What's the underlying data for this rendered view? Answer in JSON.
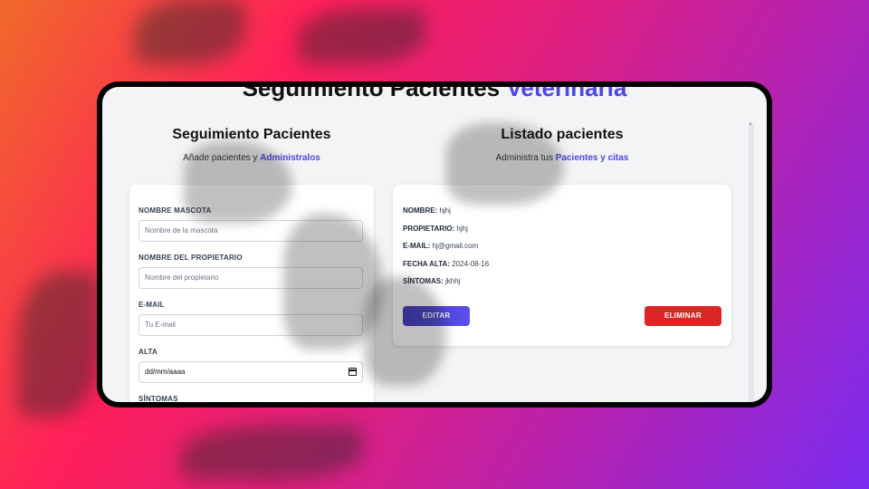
{
  "app": {
    "title_main": "Seguimiento Pacientes",
    "title_accent": "Veterinaria"
  },
  "form_section": {
    "title": "Seguimiento Pacientes",
    "subtitle_prefix": "Añade pacientes y",
    "subtitle_accent": "Administralos",
    "fields": [
      {
        "label": "NOMBRE MASCOTA",
        "placeholder": "Nombre de la mascota"
      },
      {
        "label": "NOMBRE DEL PROPIETARIO",
        "placeholder": "Nombre del propietario"
      },
      {
        "label": "E-MAIL",
        "placeholder": "Tu E-mail"
      },
      {
        "label": "ALTA",
        "placeholder": "dd/mm/aaaa"
      },
      {
        "label": "SÍNTOMAS",
        "placeholder": ""
      }
    ]
  },
  "list_section": {
    "title": "Listado pacientes",
    "subtitle_prefix": "Administra tus",
    "subtitle_accent": "Pacientes y citas",
    "patient": {
      "name_label": "NOMBRE:",
      "name": "hjhj",
      "owner_label": "PROPIETARIO:",
      "owner": "hjhj",
      "email_label": "E-MAIL:",
      "email": "hj@gmail.com",
      "date_label": "FECHA ALTA:",
      "date": "2024-08-16",
      "symptoms_label": "SÍNTOMAS:",
      "symptoms": "jkhhj"
    },
    "edit_label": "EDITAR",
    "delete_label": "ELIMINAR"
  },
  "colors": {
    "accent": "#4f46e5",
    "delete": "#dc2626"
  }
}
